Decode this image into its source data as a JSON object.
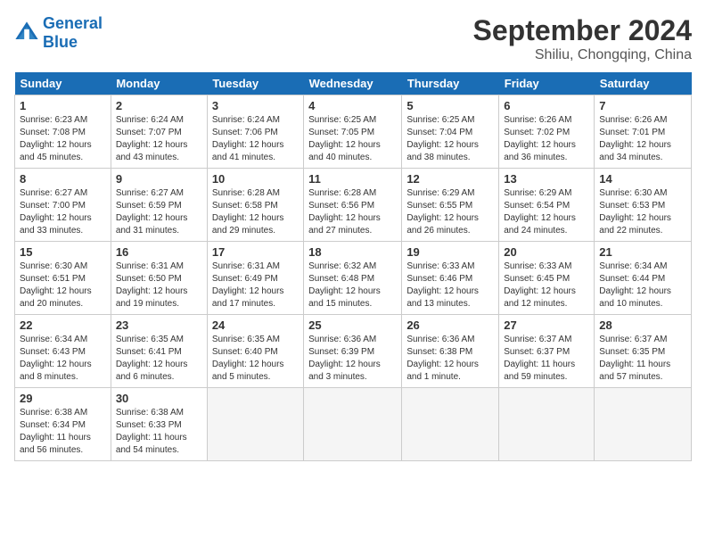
{
  "header": {
    "logo_text_general": "General",
    "logo_text_blue": "Blue",
    "title": "September 2024",
    "subtitle": "Shiliu, Chongqing, China"
  },
  "days_of_week": [
    "Sunday",
    "Monday",
    "Tuesday",
    "Wednesday",
    "Thursday",
    "Friday",
    "Saturday"
  ],
  "weeks": [
    [
      {
        "day": "1",
        "sunrise": "6:23 AM",
        "sunset": "7:08 PM",
        "daylight": "12 hours and 45 minutes."
      },
      {
        "day": "2",
        "sunrise": "6:24 AM",
        "sunset": "7:07 PM",
        "daylight": "12 hours and 43 minutes."
      },
      {
        "day": "3",
        "sunrise": "6:24 AM",
        "sunset": "7:06 PM",
        "daylight": "12 hours and 41 minutes."
      },
      {
        "day": "4",
        "sunrise": "6:25 AM",
        "sunset": "7:05 PM",
        "daylight": "12 hours and 40 minutes."
      },
      {
        "day": "5",
        "sunrise": "6:25 AM",
        "sunset": "7:04 PM",
        "daylight": "12 hours and 38 minutes."
      },
      {
        "day": "6",
        "sunrise": "6:26 AM",
        "sunset": "7:02 PM",
        "daylight": "12 hours and 36 minutes."
      },
      {
        "day": "7",
        "sunrise": "6:26 AM",
        "sunset": "7:01 PM",
        "daylight": "12 hours and 34 minutes."
      }
    ],
    [
      {
        "day": "8",
        "sunrise": "6:27 AM",
        "sunset": "7:00 PM",
        "daylight": "12 hours and 33 minutes."
      },
      {
        "day": "9",
        "sunrise": "6:27 AM",
        "sunset": "6:59 PM",
        "daylight": "12 hours and 31 minutes."
      },
      {
        "day": "10",
        "sunrise": "6:28 AM",
        "sunset": "6:58 PM",
        "daylight": "12 hours and 29 minutes."
      },
      {
        "day": "11",
        "sunrise": "6:28 AM",
        "sunset": "6:56 PM",
        "daylight": "12 hours and 27 minutes."
      },
      {
        "day": "12",
        "sunrise": "6:29 AM",
        "sunset": "6:55 PM",
        "daylight": "12 hours and 26 minutes."
      },
      {
        "day": "13",
        "sunrise": "6:29 AM",
        "sunset": "6:54 PM",
        "daylight": "12 hours and 24 minutes."
      },
      {
        "day": "14",
        "sunrise": "6:30 AM",
        "sunset": "6:53 PM",
        "daylight": "12 hours and 22 minutes."
      }
    ],
    [
      {
        "day": "15",
        "sunrise": "6:30 AM",
        "sunset": "6:51 PM",
        "daylight": "12 hours and 20 minutes."
      },
      {
        "day": "16",
        "sunrise": "6:31 AM",
        "sunset": "6:50 PM",
        "daylight": "12 hours and 19 minutes."
      },
      {
        "day": "17",
        "sunrise": "6:31 AM",
        "sunset": "6:49 PM",
        "daylight": "12 hours and 17 minutes."
      },
      {
        "day": "18",
        "sunrise": "6:32 AM",
        "sunset": "6:48 PM",
        "daylight": "12 hours and 15 minutes."
      },
      {
        "day": "19",
        "sunrise": "6:33 AM",
        "sunset": "6:46 PM",
        "daylight": "12 hours and 13 minutes."
      },
      {
        "day": "20",
        "sunrise": "6:33 AM",
        "sunset": "6:45 PM",
        "daylight": "12 hours and 12 minutes."
      },
      {
        "day": "21",
        "sunrise": "6:34 AM",
        "sunset": "6:44 PM",
        "daylight": "12 hours and 10 minutes."
      }
    ],
    [
      {
        "day": "22",
        "sunrise": "6:34 AM",
        "sunset": "6:43 PM",
        "daylight": "12 hours and 8 minutes."
      },
      {
        "day": "23",
        "sunrise": "6:35 AM",
        "sunset": "6:41 PM",
        "daylight": "12 hours and 6 minutes."
      },
      {
        "day": "24",
        "sunrise": "6:35 AM",
        "sunset": "6:40 PM",
        "daylight": "12 hours and 5 minutes."
      },
      {
        "day": "25",
        "sunrise": "6:36 AM",
        "sunset": "6:39 PM",
        "daylight": "12 hours and 3 minutes."
      },
      {
        "day": "26",
        "sunrise": "6:36 AM",
        "sunset": "6:38 PM",
        "daylight": "12 hours and 1 minute."
      },
      {
        "day": "27",
        "sunrise": "6:37 AM",
        "sunset": "6:37 PM",
        "daylight": "11 hours and 59 minutes."
      },
      {
        "day": "28",
        "sunrise": "6:37 AM",
        "sunset": "6:35 PM",
        "daylight": "11 hours and 57 minutes."
      }
    ],
    [
      {
        "day": "29",
        "sunrise": "6:38 AM",
        "sunset": "6:34 PM",
        "daylight": "11 hours and 56 minutes."
      },
      {
        "day": "30",
        "sunrise": "6:38 AM",
        "sunset": "6:33 PM",
        "daylight": "11 hours and 54 minutes."
      },
      null,
      null,
      null,
      null,
      null
    ]
  ]
}
